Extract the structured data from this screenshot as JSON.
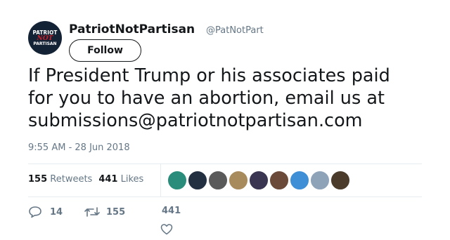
{
  "user": {
    "display_name": "PatriotNotPartisan",
    "handle": "@PatNotPart",
    "avatar_text": {
      "line1": "PATRIOT",
      "line2": "NOT",
      "line3": "PARTISAN"
    }
  },
  "follow_label": "Follow",
  "tweet": {
    "lines": [
      "If President Trump or his associates paid",
      "for you to have an abortion, email us at",
      "submissions@patriotnotpartisan.com"
    ]
  },
  "timestamp": "9:55 AM - 28 Jun 2018",
  "stats": {
    "retweets_count": "155",
    "retweets_label": "Retweets",
    "likes_count": "441",
    "likes_label": "Likes"
  },
  "liker_avatar_colors": [
    "#2a8c7a",
    "#233041",
    "#5a5a5a",
    "#a88b5c",
    "#3a3550",
    "#6b4a3a",
    "#3f8fd6",
    "#8fa3b8",
    "#4a3b2a"
  ],
  "actions": {
    "reply_count": "14",
    "retweet_count": "155",
    "like_count": "441"
  },
  "icons": {
    "reply": "reply-icon",
    "retweet": "retweet-icon",
    "like": "heart-icon"
  }
}
